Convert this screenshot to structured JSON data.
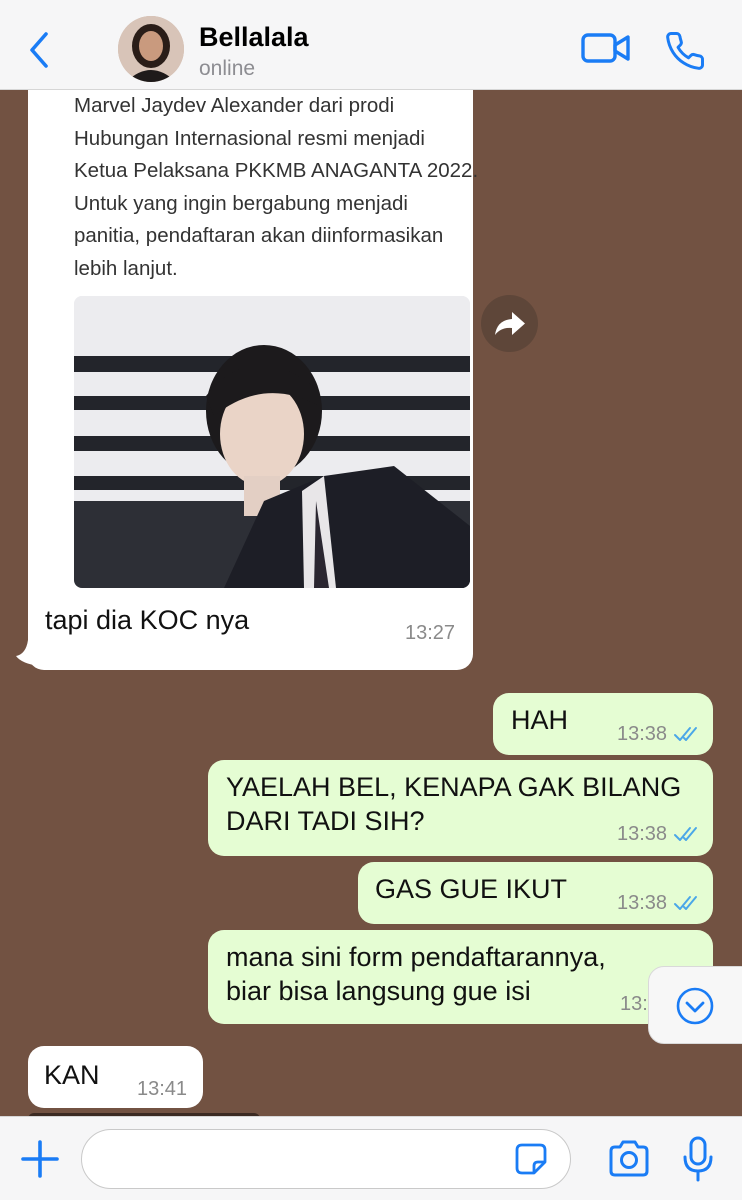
{
  "header": {
    "contact_name": "Bellalala",
    "status": "online",
    "back_icon": "chevron-left-icon",
    "video_icon": "video-camera-icon",
    "call_icon": "phone-icon"
  },
  "messages": {
    "forwarded": {
      "text_lines": [
        "Marvel Jaydev Alexander dari prodi",
        "Hubungan Internasional resmi menjadi",
        "Ketua Pelaksana PKKMB ANAGANTA 2022.",
        "Untuk yang ingin bergabung menjadi",
        "panitia, pendaftaran akan diinformasikan",
        "lebih lanjut."
      ],
      "caption": "tapi dia KOC nya",
      "time": "13:27"
    },
    "out1": {
      "text": "HAH",
      "time": "13:38"
    },
    "out2": {
      "line1": "YAELAH BEL, KENAPA GAK BILANG",
      "line2": "DARI TADI SIH?",
      "time": "13:38"
    },
    "out3": {
      "text": "GAS GUE IKUT",
      "time": "13:38"
    },
    "out4": {
      "line1": "mana sini form pendaftarannya,",
      "line2": "biar bisa langsung gue isi",
      "time": "13:"
    },
    "in2": {
      "text": "KAN",
      "time": "13:41"
    }
  },
  "footer": {
    "input_value": "",
    "input_placeholder": "",
    "add_icon": "plus-icon",
    "sticker_icon": "sticker-icon",
    "camera_icon": "camera-icon",
    "mic_icon": "microphone-icon"
  },
  "colors": {
    "accent": "#1a7cf5",
    "chat_background": "#725242",
    "outgoing_bubble": "#e5fdd3",
    "incoming_bubble": "#ffffff",
    "read_ticks": "#4aa7e8"
  }
}
